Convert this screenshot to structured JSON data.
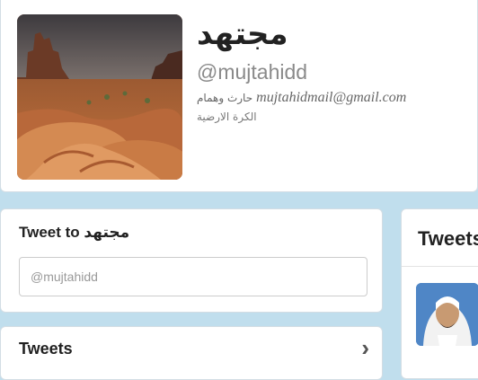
{
  "profile": {
    "name": "مجتهد",
    "handle": "@mujtahidd",
    "bio_arabic": "حارث وهمام",
    "bio_email": "mujtahidmail@gmail.com",
    "location": "الكرة الارضية"
  },
  "tweet_to": {
    "label": "Tweet to",
    "name": "مجتهد",
    "placeholder": "@mujtahidd"
  },
  "tweets_nav": {
    "label": "Tweets",
    "chevron": "›"
  },
  "tweets_panel": {
    "title": "Tweets"
  },
  "icons": {
    "chevron": "chevron-right-icon"
  }
}
